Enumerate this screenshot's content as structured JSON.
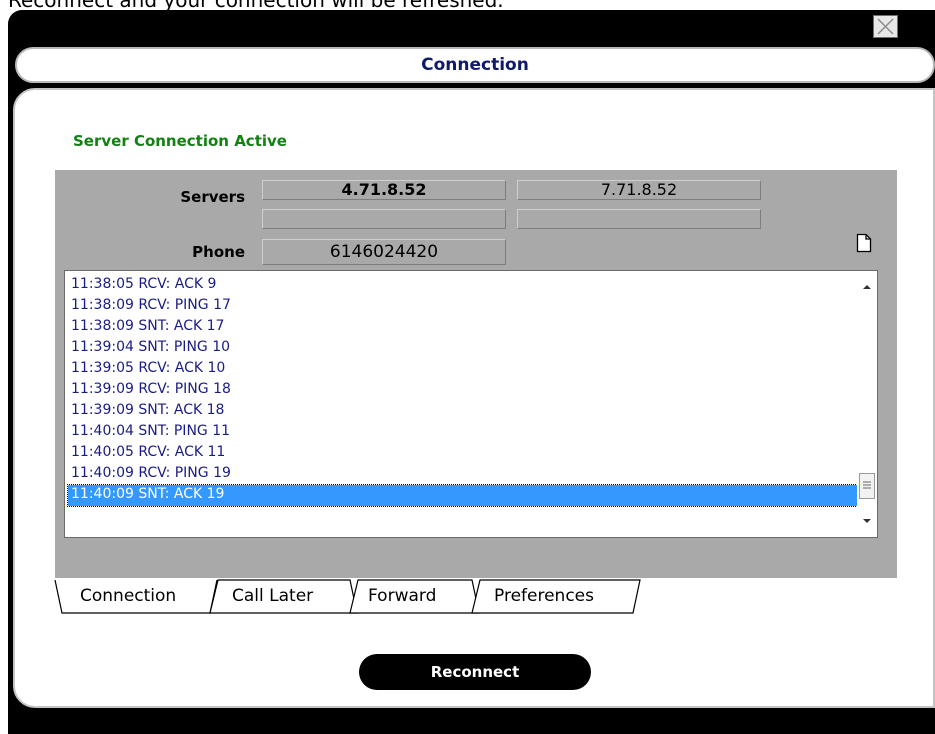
{
  "caption": "Reconnect and your connection will be refreshed.",
  "dialog": {
    "title": "Connection",
    "close_icon": "close-icon"
  },
  "status": {
    "text": "Server Connection Active",
    "color": "#128112"
  },
  "servers": {
    "label": "Servers",
    "primary": "4.71.8.52",
    "secondary": "7.71.8.52",
    "extra1": "",
    "extra2": ""
  },
  "phone": {
    "label": "Phone",
    "value": "6146024420"
  },
  "log": {
    "lines": [
      "11:38:05 RCV: ACK 9",
      "11:38:09 RCV: PING 17",
      "11:38:09 SNT: ACK 17",
      "11:39:04 SNT: PING 10",
      "11:39:05 RCV: ACK 10",
      "11:39:09 RCV: PING 18",
      "11:39:09 SNT: ACK 18",
      "11:40:04 SNT: PING 11",
      "11:40:05 RCV: ACK 11",
      "11:40:09 RCV: PING 19",
      "11:40:09 SNT: ACK 19"
    ],
    "selected_index": 10
  },
  "tabs": [
    {
      "label": "Connection",
      "active": true
    },
    {
      "label": "Call Later",
      "active": false
    },
    {
      "label": "Forward",
      "active": false
    },
    {
      "label": "Preferences",
      "active": false
    }
  ],
  "reconnect_label": "Reconnect",
  "colors": {
    "log_text": "#1a1c85",
    "selection": "#3399ff",
    "title_text": "#0f1a6b",
    "panel": "#a9a9a9"
  }
}
